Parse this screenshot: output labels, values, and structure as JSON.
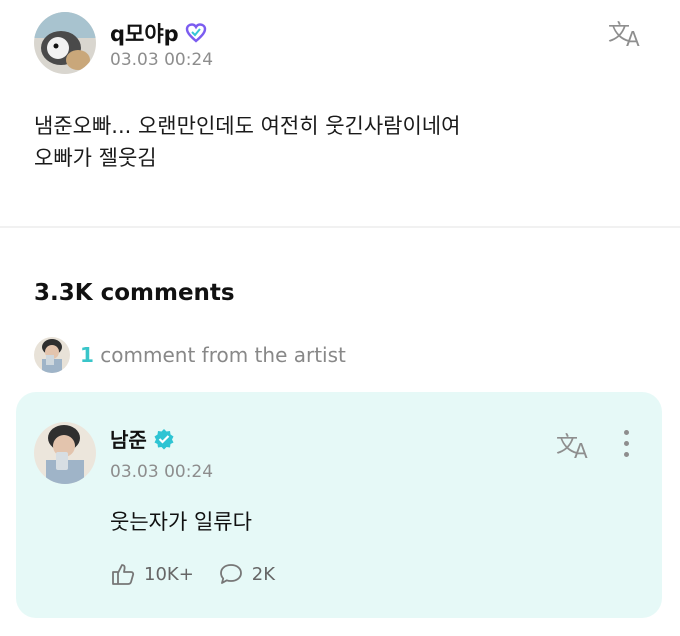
{
  "post": {
    "user_name": "q모야p",
    "time": "03.03 00:24",
    "translate_icon": "translate-icon",
    "body": "냄준오빠... 오랜만인데도 여전히 웃긴사람이네여\n오빠가 젤웃김"
  },
  "comments": {
    "count_label": "3.3K comments",
    "artist_count": "1",
    "artist_text": " comment from the artist"
  },
  "artist_comment": {
    "name": "남준",
    "time": "03.03 00:24",
    "text": "웃는자가 일류다",
    "likes": "10K+",
    "replies": "2K"
  },
  "colors": {
    "accent": "#39c5c9",
    "card_bg": "#e6f9f7",
    "heart_badge": "#7b5cf0"
  }
}
